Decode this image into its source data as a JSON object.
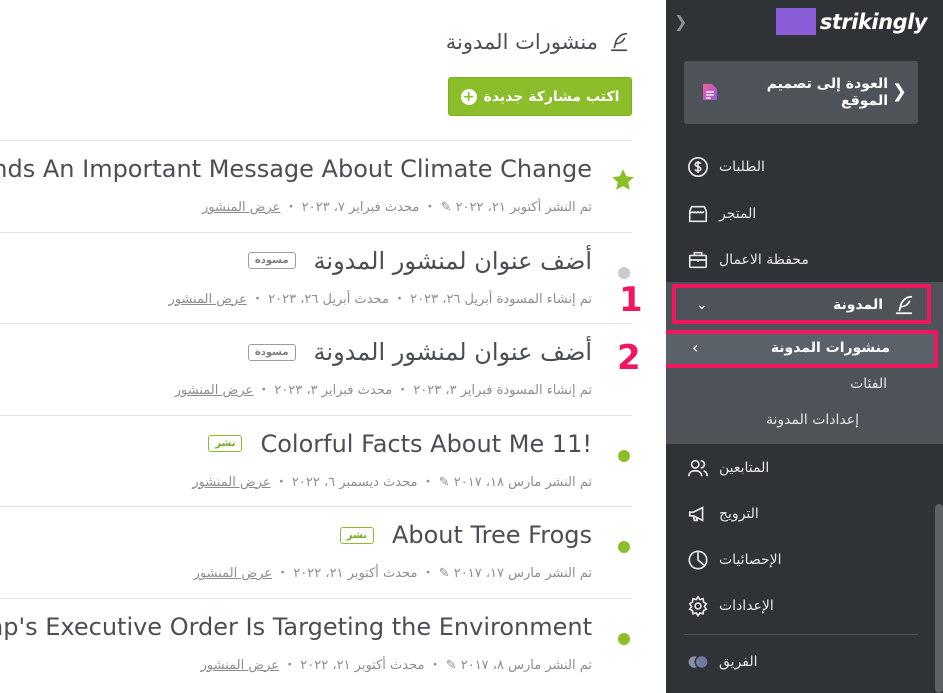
{
  "header": {
    "title": "منشورات المدونة",
    "new_post_label": "اكتب مشاركة جديدة"
  },
  "posts": [
    {
      "title": "Sends An Important Message About Climate Change",
      "meta_text": "تم النشر أكتوبر ٢١، ٢٠٢٢ ✎ ・ محدث فبراير ٧، ٢٠٢٣ ・ ",
      "view_label": "عرض المنشور",
      "status": "featured",
      "badge": ""
    },
    {
      "title": "أضف عنوان لمنشور المدونة",
      "meta_text": "تم إنشاء المسودة أبريل ٢٦، ٢٠٢٣ ・ محدث أبريل ٢٦، ٢٠٢٣ ・ ",
      "view_label": "عرض المنشور",
      "status": "draft",
      "badge": "مسودة"
    },
    {
      "title": "أضف عنوان لمنشور المدونة",
      "meta_text": "تم إنشاء المسودة فبراير ٣، ٢٠٢٣ ・ محدث فبراير ٣، ٢٠٢٣ ・ ",
      "view_label": "عرض المنشور",
      "status": "draft",
      "badge": "مسودة"
    },
    {
      "title": "Colorful Facts About Me 11!",
      "meta_text": "تم النشر مارس ١٨، ٢٠١٧ ✎ ・ محدث ديسمبر ٦، ٢٠٢٢ ・ ",
      "view_label": "عرض المنشور",
      "status": "published",
      "badge": "نشر"
    },
    {
      "title": "About Tree Frogs",
      "meta_text": "تم النشر مارس ١٧، ٢٠١٧ ✎ ・ محدث أكتوبر ٢١، ٢٠٢٢ ・ ",
      "view_label": "عرض المنشور",
      "status": "published",
      "badge": "نشر"
    },
    {
      "title": "ump's Executive Order Is Targeting the Environment",
      "meta_text": "تم النشر مارس ٨، ٢٠١٧ ✎ ・ محدث أكتوبر ٢١، ٢٠٢٢ ・ ",
      "view_label": "عرض المنشور",
      "status": "published",
      "badge": ""
    }
  ],
  "sidebar": {
    "brand": "strikingly",
    "back_label": "العودة إلى تصميم الموقع",
    "items": {
      "orders": "الطلبات",
      "store": "المتجر",
      "portfolio": "محفظة الاعمال",
      "blog": "المدونة",
      "blog_posts": "منشورات المدونة",
      "categories": "الفئات",
      "blog_settings": "إعدادات المدونة",
      "followers": "المتابعين",
      "promotion": "الترويج",
      "stats": "الإحصائيات",
      "settings": "الإعدادات",
      "team": "الفريق"
    },
    "markers": [
      "1",
      "2"
    ]
  },
  "colors": {
    "accent_green": "#8cbd2b",
    "sidebar_bg": "#2f3338",
    "highlight_pink": "#f0175f",
    "brand_purple": "#8a5ed8"
  }
}
